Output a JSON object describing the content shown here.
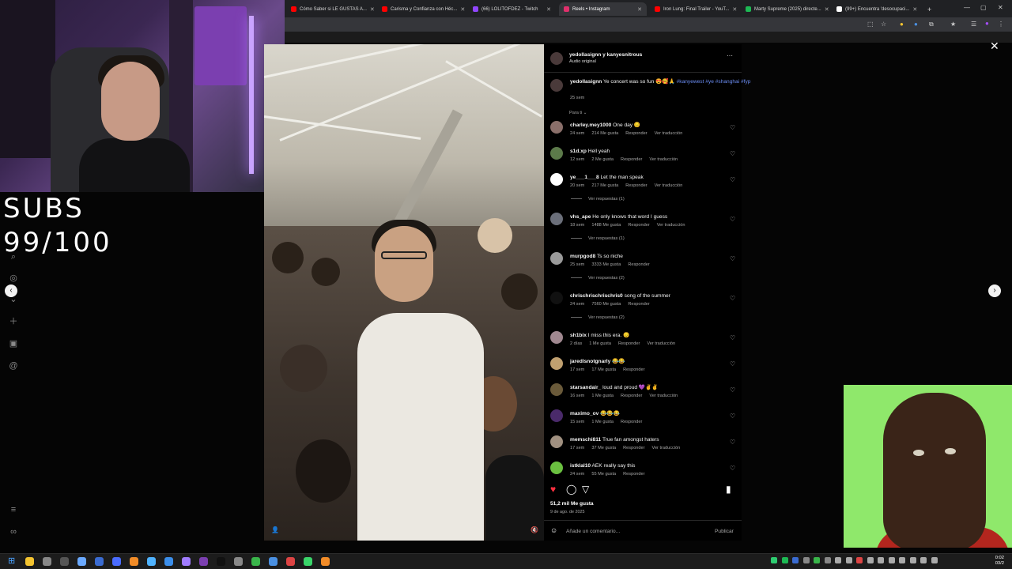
{
  "browser": {
    "tabs": [
      {
        "title": "Cómo Saber si LE GUSTAS A...",
        "favicon_color": "#ff0000"
      },
      {
        "title": "Carisma y Confianza con Héc...",
        "favicon_color": "#ff0000"
      },
      {
        "title": "(66) LOLITOFDEZ - Twitch",
        "favicon_color": "#9146ff"
      },
      {
        "title": "Reels • Instagram",
        "favicon_color": "#e1306c",
        "active": true
      },
      {
        "title": "Iron Lung: Final Trailer - YouT...",
        "favicon_color": "#ff0000"
      },
      {
        "title": "Marty Supreme (2025) directe...",
        "favicon_color": "#1db954"
      },
      {
        "title": "(99+) Encuentra 'desocupaci...",
        "favicon_color": "#ffffff"
      }
    ],
    "new_tab": "+",
    "window_controls": {
      "minimize": "—",
      "maximize": "▢",
      "close": "✕"
    }
  },
  "overlay": {
    "subs_line1": "SUBS",
    "subs_line2": "99/100"
  },
  "reel": {
    "header_user": "yedollasignn y kanyesnitrous",
    "header_audio": "Audio original",
    "more_icon": "···",
    "caption_user": "yedollasignn",
    "caption_text": "Ye concert was so fun 😍🥰🙏",
    "caption_tags": "#kanyewest #ye #shanghai #fyp",
    "caption_time": "25 sem",
    "sort_label": "Para ti ⌄",
    "comments": [
      {
        "user": "charley.mey1000",
        "text": "One day 😔",
        "time": "24 sem",
        "likes": "214 Me gusta",
        "reply": "Responder",
        "translate": "Ver traducción",
        "avatar": "#8a6f6a"
      },
      {
        "user": "s1d.xp",
        "text": "Hell yeah",
        "time": "12 sem",
        "likes": "2 Me gusta",
        "reply": "Responder",
        "translate": "Ver traducción",
        "avatar": "#5c7a4a"
      },
      {
        "user": "ye___1___8",
        "text": "Let the man speak",
        "time": "20 sem",
        "likes": "217 Me gusta",
        "reply": "Responder",
        "translate": "Ver traducción",
        "avatar": "#ffffff",
        "replies": "Ver respuestas (1)"
      },
      {
        "user": "vhs_ape",
        "text": "He only knows that word I guess",
        "time": "18 sem",
        "likes": "1488 Me gusta",
        "reply": "Responder",
        "translate": "Ver traducción",
        "avatar": "#6b6f7a",
        "replies": "Ver respuestas (1)"
      },
      {
        "user": "murpgod8",
        "text": "Ts so niche",
        "time": "25 sem",
        "likes": "3333 Me gusta",
        "reply": "Responder",
        "translate": "",
        "avatar": "#9a9a9a",
        "replies": "Ver respuestas (2)"
      },
      {
        "user": "chrischrischrischris0",
        "text": "song of the summer",
        "time": "24 sem",
        "likes": "7560 Me gusta",
        "reply": "Responder",
        "translate": "",
        "avatar": "#111111",
        "replies": "Ver respuestas (2)"
      },
      {
        "user": "sh1bix",
        "text": "I miss this era. 😔",
        "time": "2 días",
        "likes": "1 Me gusta",
        "reply": "Responder",
        "translate": "Ver traducción",
        "avatar": "#a08890"
      },
      {
        "user": "jaredlsnotgnarly",
        "text": "😂😂",
        "time": "17 sem",
        "likes": "17 Me gusta",
        "reply": "Responder",
        "translate": "",
        "avatar": "#c0a070"
      },
      {
        "user": "starsandair_",
        "text": "loud and proud 💜✌✌",
        "time": "16 sem",
        "likes": "1 Me gusta",
        "reply": "Responder",
        "translate": "Ver traducción",
        "avatar": "#6a5a3a"
      },
      {
        "user": "maximo_ov",
        "text": "😂😂😂",
        "time": "15 sem",
        "likes": "1 Me gusta",
        "reply": "Responder",
        "translate": "",
        "avatar": "#4a2a6a"
      },
      {
        "user": "memschi811",
        "text": "True fan amongst haters",
        "time": "17 sem",
        "likes": "37 Me gusta",
        "reply": "Responder",
        "translate": "Ver traducción",
        "avatar": "#a09080"
      },
      {
        "user": "istklal10",
        "text": "AEK really say this",
        "time": "24 sem",
        "likes": "55 Me gusta",
        "reply": "Responder",
        "translate": "",
        "avatar": "#6ac040"
      }
    ],
    "likes_count": "51,2 mil Me gusta",
    "post_date": "9 de ago. de 2025",
    "comment_placeholder": "Añade un comentario...",
    "publish_label": "Publicar"
  },
  "taskbar": {
    "time": "0:02",
    "date": "03/2"
  },
  "colors": {
    "like_red": "#ff3040",
    "tag_blue": "#6c8ef5",
    "link_blue": "#4a90e2"
  }
}
